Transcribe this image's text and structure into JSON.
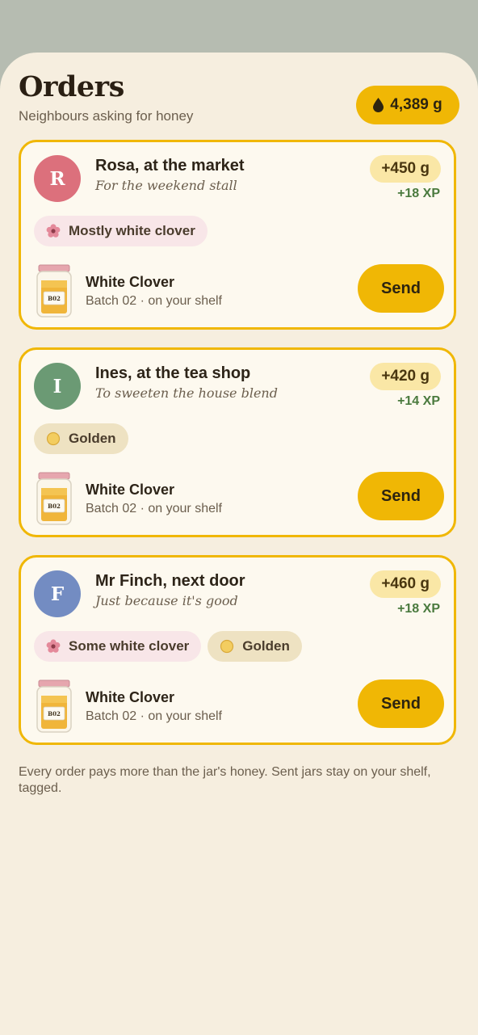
{
  "header": {
    "title": "Orders",
    "subtitle": "Neighbours asking for honey",
    "balance": "4,389 g",
    "balance_icon": "honey-drop-icon"
  },
  "orders": [
    {
      "initial": "R",
      "avatar_color": "#dc707c",
      "name": "Rosa, at the market",
      "note": "For the weekend stall",
      "reward": "+450 g",
      "xp": "+18 XP",
      "tags": [
        {
          "label": "Mostly white clover",
          "icon": "flower-icon"
        }
      ],
      "product": "White Clover",
      "batch": "Batch 02 · on your shelf",
      "jar_label": "B02",
      "send_label": "Send"
    },
    {
      "initial": "I",
      "avatar_color": "#6b9a74",
      "name": "Ines, at the tea shop",
      "note": "To sweeten the house blend",
      "reward": "+420 g",
      "xp": "+14 XP",
      "tags": [
        {
          "label": "Golden",
          "icon": "golden-swatch-icon"
        }
      ],
      "product": "White Clover",
      "batch": "Batch 02 · on your shelf",
      "jar_label": "B02",
      "send_label": "Send"
    },
    {
      "initial": "F",
      "avatar_color": "#738cc2",
      "name": "Mr Finch, next door",
      "note": "Just because it's good",
      "reward": "+460 g",
      "xp": "+18 XP",
      "tags": [
        {
          "label": "Some white clover",
          "icon": "flower-icon"
        },
        {
          "label": "Golden",
          "icon": "golden-swatch-icon"
        }
      ],
      "product": "White Clover",
      "batch": "Batch 02 · on your shelf",
      "jar_label": "B02",
      "send_label": "Send"
    }
  ],
  "footer": "Every order pays more than the jar's honey. Sent jars stay on your shelf, tagged.",
  "colors": {
    "accent": "#f0b705",
    "background": "#f6eedf",
    "card": "#fdf9ef",
    "xp": "#4a7a3e",
    "clover_tag": "#f8e6e8",
    "golden_tag": "#eee2c2"
  }
}
